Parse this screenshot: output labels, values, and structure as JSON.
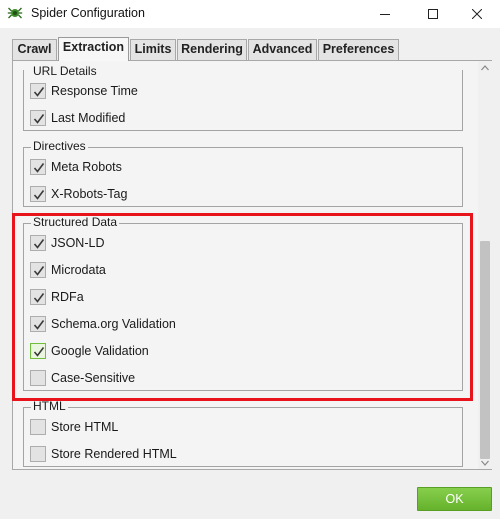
{
  "window": {
    "title": "Spider Configuration",
    "icon": "spider-icon",
    "controls": [
      "minimize-icon",
      "maximize-icon",
      "close-icon"
    ]
  },
  "tabs": [
    {
      "label": "Crawl",
      "active": false
    },
    {
      "label": "Extraction",
      "active": true
    },
    {
      "label": "Limits",
      "active": false
    },
    {
      "label": "Rendering",
      "active": false
    },
    {
      "label": "Advanced",
      "active": false
    },
    {
      "label": "Preferences",
      "active": false
    }
  ],
  "groups": {
    "url_details": {
      "title": "URL Details",
      "items": [
        {
          "label": "Response Time",
          "checked": true
        },
        {
          "label": "Last Modified",
          "checked": true
        }
      ]
    },
    "directives": {
      "title": "Directives",
      "items": [
        {
          "label": "Meta Robots",
          "checked": true
        },
        {
          "label": "X-Robots-Tag",
          "checked": true
        }
      ]
    },
    "structured_data": {
      "title": "Structured Data",
      "highlighted": true,
      "items": [
        {
          "label": "JSON-LD",
          "checked": true
        },
        {
          "label": "Microdata",
          "checked": true
        },
        {
          "label": "RDFa",
          "checked": true
        },
        {
          "label": "Schema.org Validation",
          "checked": true
        },
        {
          "label": "Google Validation",
          "checked": true,
          "focused": true
        },
        {
          "label": "Case-Sensitive",
          "checked": false
        }
      ]
    },
    "html": {
      "title": "HTML",
      "items": [
        {
          "label": "Store HTML",
          "checked": false
        },
        {
          "label": "Store Rendered HTML",
          "checked": false
        }
      ]
    }
  },
  "buttons": {
    "ok_label": "OK"
  },
  "colors": {
    "accent_green": "#6cb832",
    "highlight_red": "#e8141c",
    "check_gray": "#3a3a3a",
    "focus_green": "#6fbf3b"
  }
}
